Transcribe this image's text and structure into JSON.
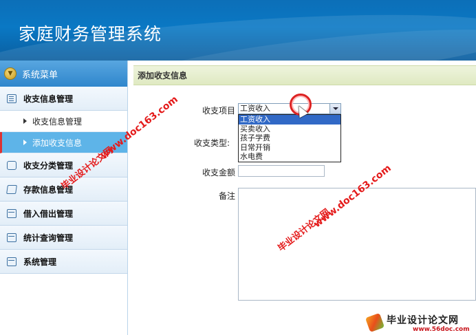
{
  "header": {
    "title": "家庭财务管理系统"
  },
  "sidebar": {
    "title": "系统菜单",
    "groups": [
      {
        "label": "收支信息管理",
        "items": [
          "收支信息管理",
          "添加收支信息"
        ]
      },
      {
        "label": "收支分类管理"
      },
      {
        "label": "存款信息管理"
      },
      {
        "label": "借入借出管理"
      },
      {
        "label": "统计查询管理"
      },
      {
        "label": "系统管理"
      }
    ],
    "active_item": "添加收支信息"
  },
  "main": {
    "section_title": "添加收支信息",
    "form": {
      "item_label": "收支项目",
      "item_selected": "工资收入",
      "item_options": [
        "工资收入",
        "买卖收入",
        "孩子学费",
        "日常开销",
        "水电费"
      ],
      "type_label": "收支类型:",
      "amount_label": "收支金额",
      "amount_value": "",
      "remark_label": "备注",
      "remark_value": ""
    }
  },
  "watermarks": {
    "url1": "www.doc163.com",
    "text1": "毕业设计论文网",
    "url2": "www.doc163.com",
    "text2": "毕业设计论文网",
    "logo_text": "毕业设计论文网",
    "logo_url": "www.56doc.com"
  },
  "colors": {
    "header": "#0a78c4",
    "active_item": "#5eb4e8",
    "watermark": "#e41b1b",
    "section_head": "#dfe9c2"
  }
}
